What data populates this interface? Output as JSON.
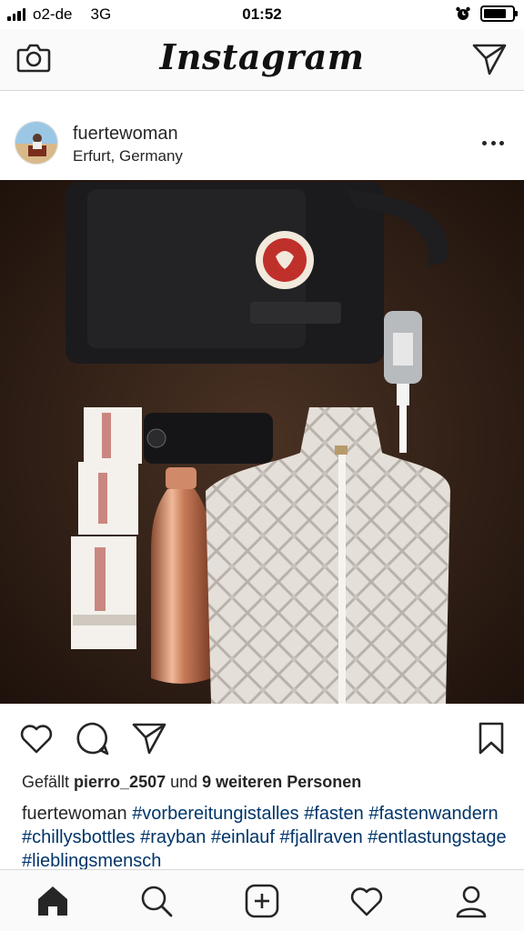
{
  "status_bar": {
    "carrier": "o2-de",
    "network": "3G",
    "time": "01:52",
    "alarm_icon": "alarm-clock-icon",
    "battery_icon": "battery-icon",
    "battery_level": 0.8
  },
  "nav": {
    "logo": "Instagram",
    "camera_icon": "camera-icon",
    "direct_icon": "paper-plane-icon"
  },
  "post": {
    "username": "fuertewoman",
    "location": "Erfurt, Germany",
    "more_icon": "more-dots-icon",
    "likes": {
      "prefix": "Gefällt ",
      "user": "pierro_2507",
      "middle": " und ",
      "count_text": "9 weiteren Personen"
    },
    "caption": {
      "author": "fuertewoman",
      "hashtags": [
        "#vorbereitungistalles",
        "#fasten",
        "#fastenwandern",
        "#chillysbottles",
        "#rayban",
        "#einlauf",
        "#fjallraven",
        "#entlastungstage",
        "#lieblingsmensch"
      ]
    }
  },
  "actions": {
    "like_icon": "heart-icon",
    "comment_icon": "comment-bubble-icon",
    "share_icon": "paper-plane-icon",
    "save_icon": "bookmark-icon"
  },
  "tabbar": {
    "items": [
      "home-icon",
      "search-icon",
      "add-post-icon",
      "activity-heart-icon",
      "profile-icon"
    ]
  },
  "colors": {
    "text": "#262626",
    "hashtag": "#003569",
    "bar_bg": "#fafafa",
    "divider": "#d8d8d8"
  }
}
